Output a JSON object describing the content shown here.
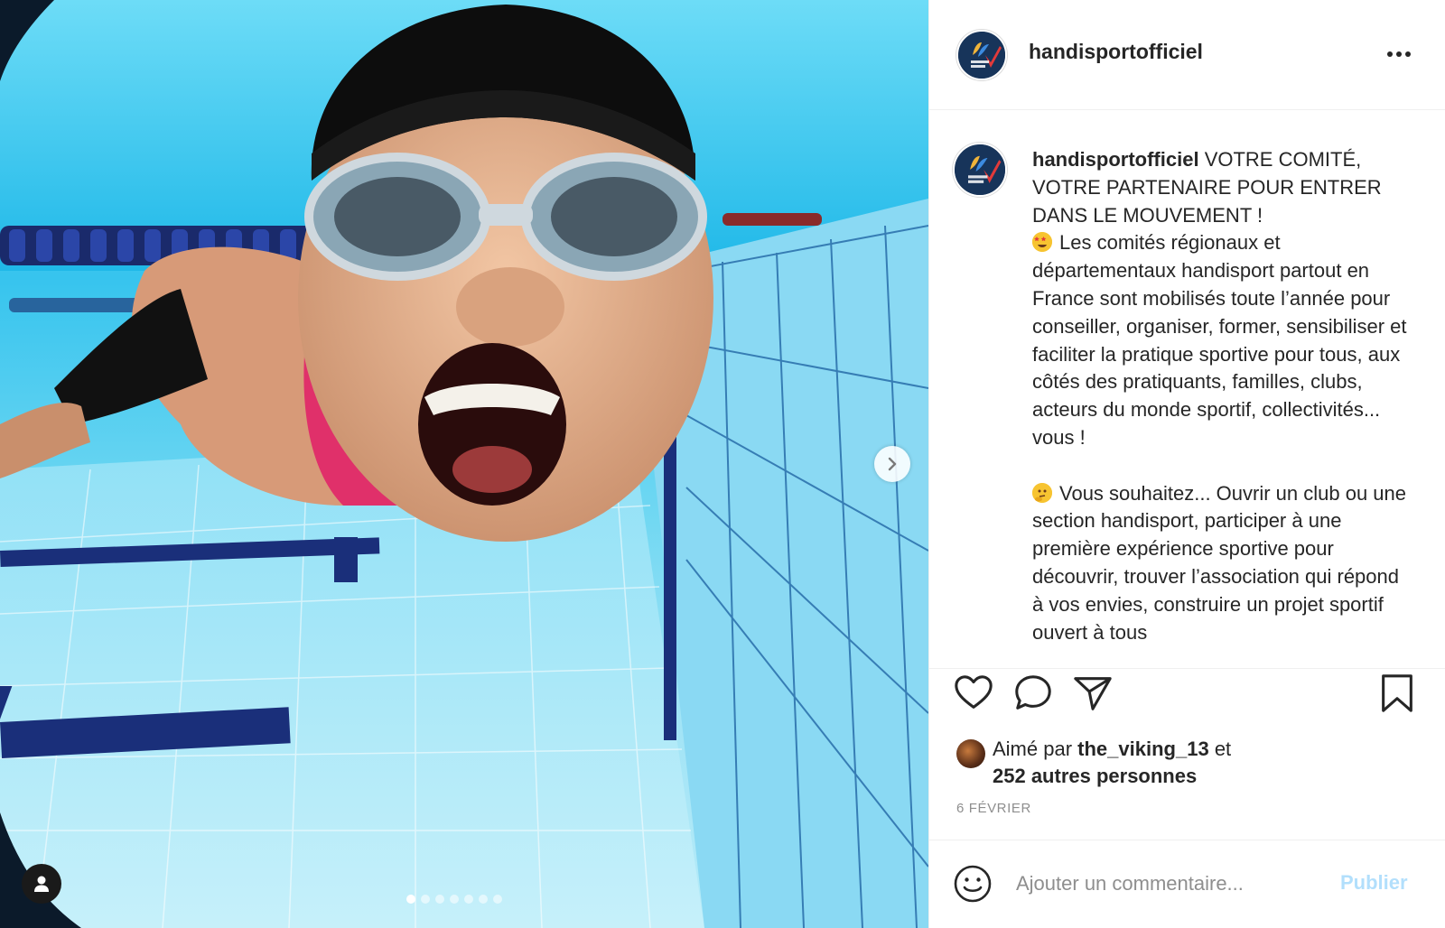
{
  "post": {
    "username": "handisportofficiel",
    "avatar_icon": "handisport-logo-icon",
    "caption_lines_first": [
      "VOTRE COMITÉ,",
      "VOTRE PARTENAIRE POUR ENTRER",
      "DANS LE MOUVEMENT !"
    ],
    "paragraph1": "Les comités régionaux et départementaux handisport partout en France sont mobilisés toute l’année pour conseiller, organiser, former, sensibiliser et faciliter la pratique sportive pour tous, aux côtés des pratiquants, familles, clubs, acteurs du monde sportif, collectivités... vous !",
    "paragraph2": "Vous souhaitez... Ouvrir un club ou une section handisport, participer à une première expérience sportive pour découvrir, trouver l’association qui répond à vos envies, construire un projet sportif ouvert à tous",
    "emoji1": "star-struck-emoji-icon",
    "emoji2": "thinking-emoji-icon"
  },
  "likes": {
    "prefix": "Aimé par",
    "liker": "the_viking_13",
    "connector": "et",
    "others": "252 autres personnes"
  },
  "date": "6 FÉVRIER",
  "comment": {
    "placeholder": "Ajouter un commentaire...",
    "publish_label": "Publier"
  },
  "carousel": {
    "total_slides": 7,
    "current_slide": 1
  },
  "icons": {
    "like": "heart-icon",
    "comment": "comment-bubble-icon",
    "share": "send-paper-plane-icon",
    "save": "bookmark-icon",
    "more": "more-options-icon",
    "next": "chevron-right-icon",
    "tag": "user-tag-icon",
    "emoji_picker": "smiley-icon"
  },
  "colors": {
    "link_blue_disabled": "#b2dffc",
    "secondary_text": "#8e8e8e",
    "primary_text": "#262626",
    "divider": "#efefef"
  }
}
